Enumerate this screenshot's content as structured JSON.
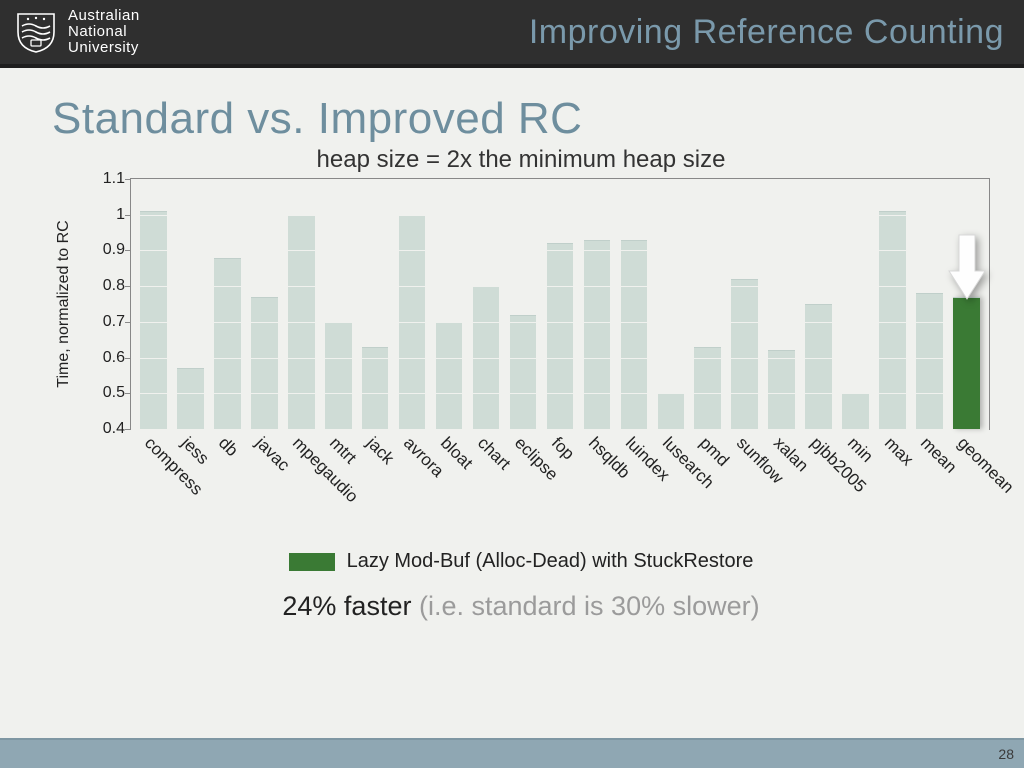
{
  "header": {
    "institution_line1": "Australian",
    "institution_line2": "National",
    "institution_line3": "University",
    "title": "Improving Reference Counting"
  },
  "slide": {
    "title": "Standard vs. Improved RC",
    "page_number": "28"
  },
  "legend": {
    "label": "Lazy Mod-Buf (Alloc-Dead) with StuckRestore",
    "swatch_color": "#3a7a34"
  },
  "conclusion": {
    "strong": "24% faster",
    "weak": " (i.e. standard is 30% slower)"
  },
  "chart_data": {
    "type": "bar",
    "title": "heap size = 2x the minimum heap size",
    "ylabel": "Time, normalized to RC",
    "xlabel": "",
    "ylim": [
      0.4,
      1.1
    ],
    "yticks": [
      0.4,
      0.5,
      0.6,
      0.7,
      0.8,
      0.9,
      1,
      1.1
    ],
    "categories": [
      "compress",
      "jess",
      "db",
      "javac",
      "mpegaudio",
      "mtrt",
      "jack",
      "avrora",
      "bloat",
      "chart",
      "eclipse",
      "fop",
      "hsqldb",
      "luindex",
      "lusearch",
      "pmd",
      "sunflow",
      "xalan",
      "pjbb2005",
      "min",
      "max",
      "mean",
      "geomean"
    ],
    "values": [
      1.01,
      0.57,
      0.88,
      0.77,
      1.0,
      0.7,
      0.63,
      1.0,
      0.7,
      0.8,
      0.72,
      0.92,
      0.93,
      0.93,
      0.5,
      0.63,
      0.82,
      0.62,
      0.75,
      0.5,
      1.01,
      0.78,
      0.77
    ],
    "highlight_index": 22,
    "highlight_color": "#3a7a34",
    "bar_color": "#cfdcd6"
  }
}
